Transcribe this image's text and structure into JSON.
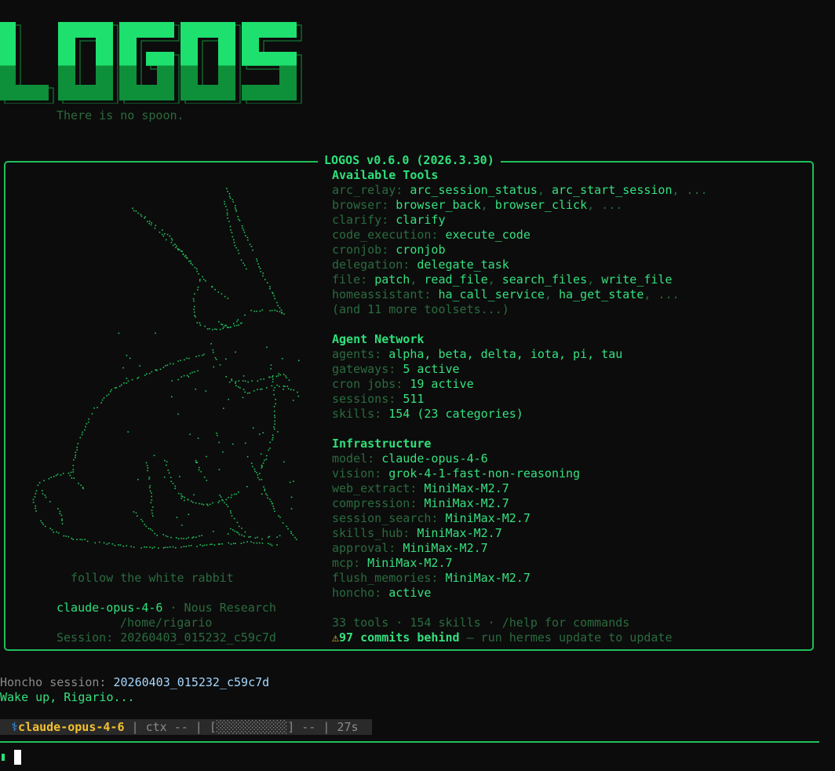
{
  "banner": {
    "logo_text": "LOGOS",
    "tagline": "There is no spoon."
  },
  "panel": {
    "title": "LOGOS v0.6.0 (2026.3.30)",
    "art_caption": "follow the white rabbit",
    "model": "claude-opus-4-6",
    "provider": " · Nous Research",
    "cwd": "/home/rigario",
    "session": "Session: 20260403_015232_c59c7d"
  },
  "tools": {
    "header": "Available Tools",
    "rows": [
      {
        "key": "arc_relay:",
        "items": [
          "arc_session_status",
          "arc_start_session"
        ],
        "more": true
      },
      {
        "key": "browser:",
        "items": [
          "browser_back",
          "browser_click"
        ],
        "more": true
      },
      {
        "key": "clarify:",
        "items": [
          "clarify"
        ],
        "more": false
      },
      {
        "key": "code_execution:",
        "items": [
          "execute_code"
        ],
        "more": false
      },
      {
        "key": "cronjob:",
        "items": [
          "cronjob"
        ],
        "more": false
      },
      {
        "key": "delegation:",
        "items": [
          "delegate_task"
        ],
        "more": false
      },
      {
        "key": "file:",
        "items": [
          "patch",
          "read_file",
          "search_files",
          "write_file"
        ],
        "more": false
      },
      {
        "key": "homeassistant:",
        "items": [
          "ha_call_service",
          "ha_get_state"
        ],
        "more": true
      }
    ],
    "more_toolsets": "(and 11 more toolsets...)"
  },
  "network": {
    "header": "Agent Network",
    "rows": [
      {
        "key": "agents:",
        "value": "alpha, beta, delta, iota, pi, tau"
      },
      {
        "key": "gateways:",
        "value": "5 active"
      },
      {
        "key": "cron jobs:",
        "value": "19 active"
      },
      {
        "key": "sessions:",
        "value": "511"
      },
      {
        "key": "skills:",
        "value": "154 (23 categories)"
      }
    ]
  },
  "infra": {
    "header": "Infrastructure",
    "rows": [
      {
        "key": "model:",
        "value": "claude-opus-4-6"
      },
      {
        "key": "vision:",
        "value": "grok-4-1-fast-non-reasoning"
      },
      {
        "key": "web_extract:",
        "value": "MiniMax-M2.7"
      },
      {
        "key": "compression:",
        "value": "MiniMax-M2.7"
      },
      {
        "key": "session_search:",
        "value": "MiniMax-M2.7"
      },
      {
        "key": "skills_hub:",
        "value": "MiniMax-M2.7"
      },
      {
        "key": "approval:",
        "value": "MiniMax-M2.7"
      },
      {
        "key": "mcp:",
        "value": "MiniMax-M2.7"
      },
      {
        "key": "flush_memories:",
        "value": "MiniMax-M2.7"
      },
      {
        "key": "honcho:",
        "value": "active"
      }
    ]
  },
  "footer": {
    "summary": "33 tools · 154 skills · /help for commands",
    "warn_icon": "⚠",
    "warn_bold": "97 commits behind",
    "warn_rest": " — run hermes update to update"
  },
  "session": {
    "honcho_label": "Honcho session: ",
    "honcho_id": "20260403_015232_c59c7d",
    "greeting": "Wake up, Rigario..."
  },
  "statusbar": {
    "icon": "⚕",
    "model": "claude-opus-4-6",
    "ctx": " | ctx -- | [",
    "bar": "░░░░░░░░░░",
    "ctx_end": "] -- | 27s "
  },
  "colors": {
    "accent": "#2ee07a",
    "dim": "#2a6b3f",
    "border": "#1fbf5a",
    "warning": "#f2c12e",
    "session_id": "#a5d8ff"
  }
}
